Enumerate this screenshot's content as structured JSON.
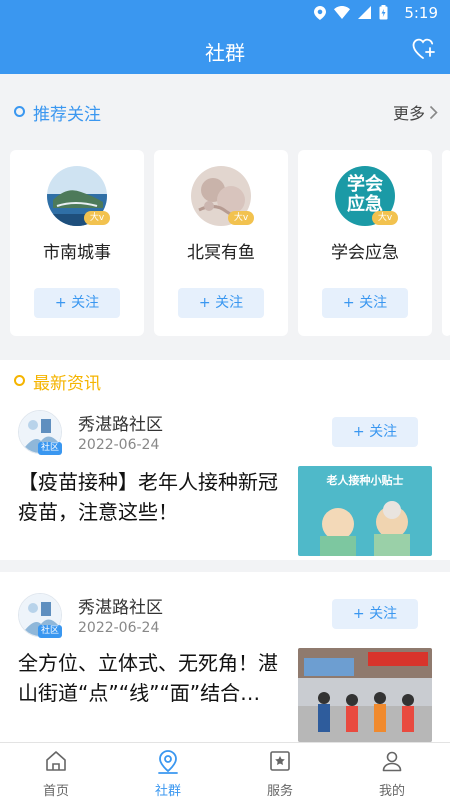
{
  "status_bar": {
    "time": "5:19"
  },
  "nav": {
    "title": "社群"
  },
  "recommend": {
    "title": "推荐关注",
    "more": "更多",
    "badge": "大v",
    "follow_label": "+ 关注",
    "cards": [
      {
        "name": "市南城事"
      },
      {
        "name": "北冥有鱼"
      },
      {
        "name": "学会应急",
        "avatar_text": "学会应急"
      }
    ]
  },
  "news": {
    "title": "最新资讯",
    "badge": "社区",
    "follow_label": "+ 关注",
    "items": [
      {
        "source": "秀湛路社区",
        "date": "2022-06-24",
        "title": "【疫苗接种】老年人接种新冠疫苗，注意这些！",
        "thumb_text": "老人接种小贴士"
      },
      {
        "source": "秀湛路社区",
        "date": "2022-06-24",
        "title": "全方位、立体式、无死角！湛山街道“点”“线”“面”结合…"
      }
    ]
  },
  "tabs": [
    {
      "label": "首页",
      "icon": "home-icon"
    },
    {
      "label": "社群",
      "icon": "location-icon"
    },
    {
      "label": "服务",
      "icon": "service-icon"
    },
    {
      "label": "我的",
      "icon": "user-icon"
    }
  ],
  "colors": {
    "brand": "#3a97f0",
    "news_accent": "#f5b400",
    "vip_badge": "#f2c24f"
  }
}
